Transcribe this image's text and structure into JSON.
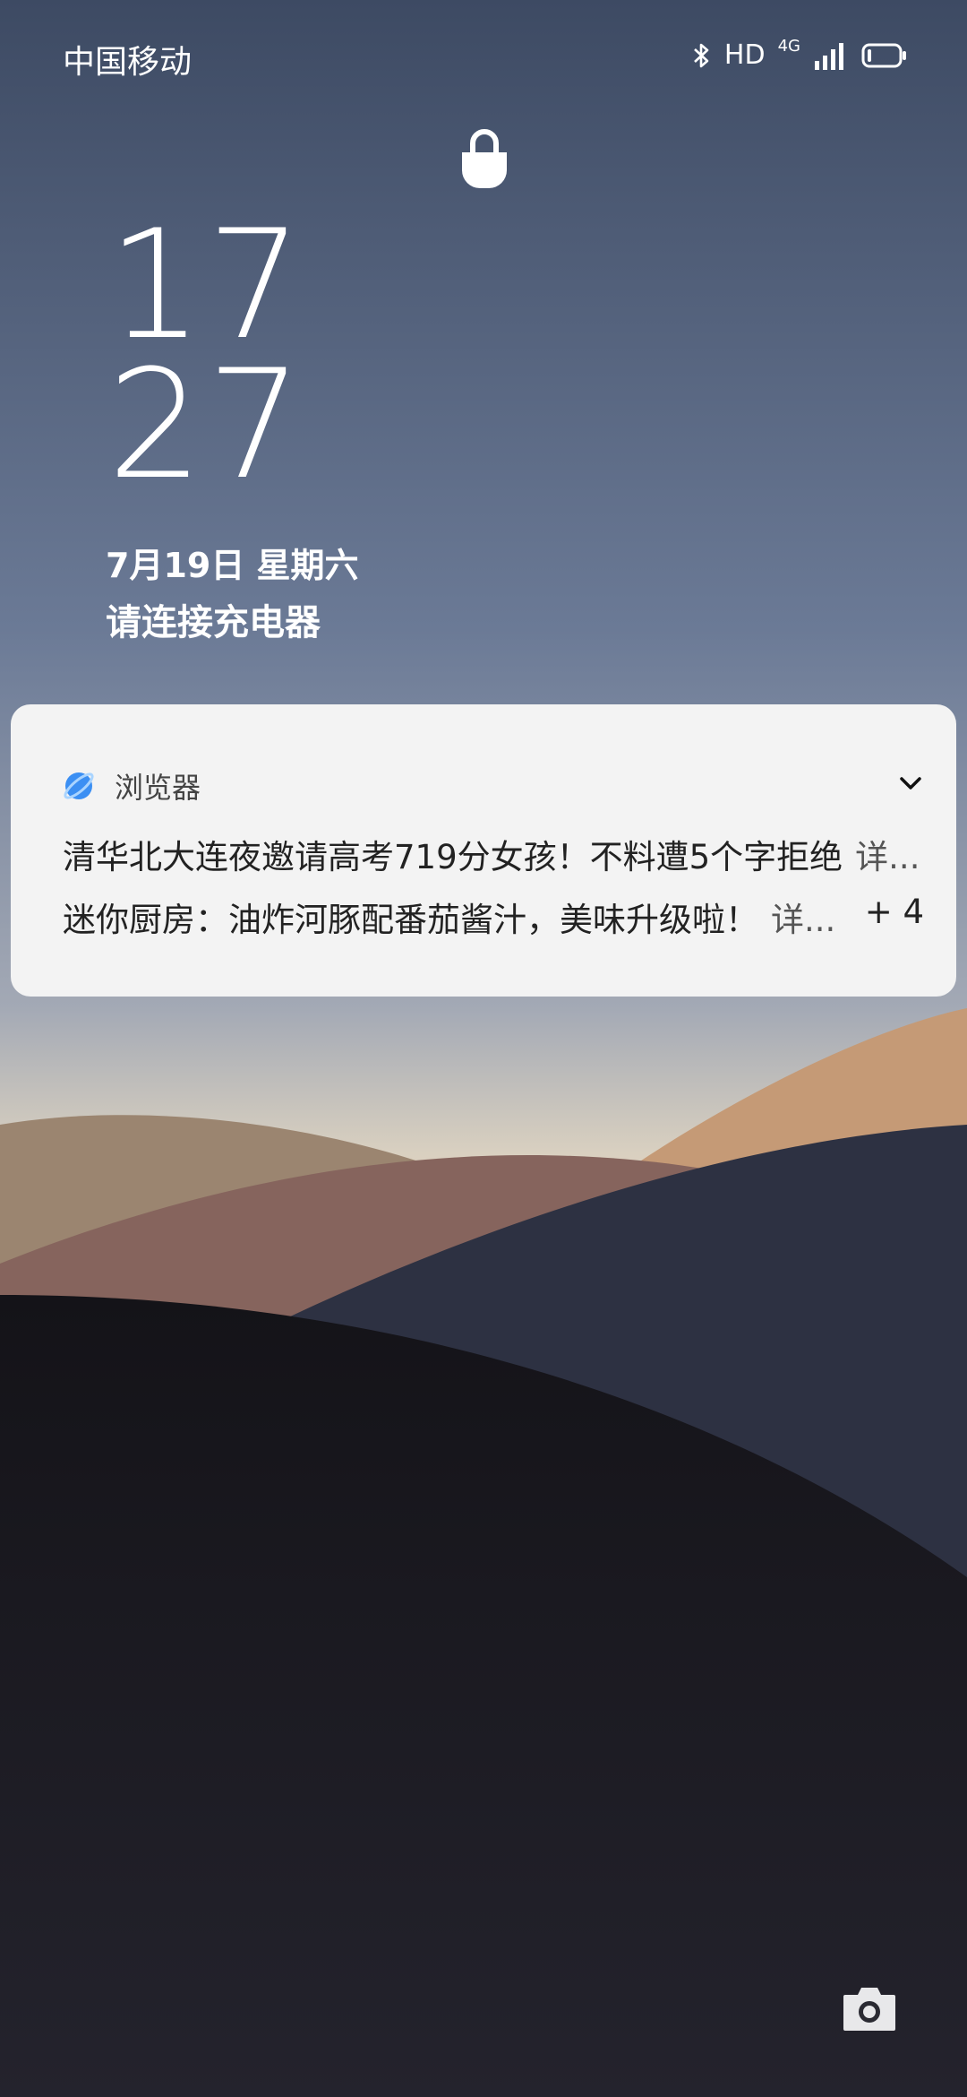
{
  "status_bar": {
    "carrier": "中国移动",
    "bluetooth_icon": "bluetooth-icon",
    "hd": "HD",
    "network": "4G",
    "signal_icon": "signal-icon",
    "battery_icon": "battery-icon"
  },
  "lockscreen": {
    "lock_icon": "lock-icon",
    "clock_hour": "17",
    "clock_minute": "27",
    "date": "7月19日  星期六",
    "charging_hint": "请连接充电器"
  },
  "notification": {
    "app_icon": "browser-icon",
    "app_name": "浏览器",
    "expand_icon": "chevron-down-icon",
    "messages": [
      {
        "title": "清华北大连夜邀请高考719分女孩！不料遭5个字拒绝",
        "more": "详..."
      },
      {
        "title": "迷你厨房：油炸河豚配番茄酱汁，美味升级啦！",
        "more": "详..."
      }
    ],
    "more_count": "+ 4"
  },
  "shortcuts": {
    "camera_icon": "camera-icon"
  }
}
